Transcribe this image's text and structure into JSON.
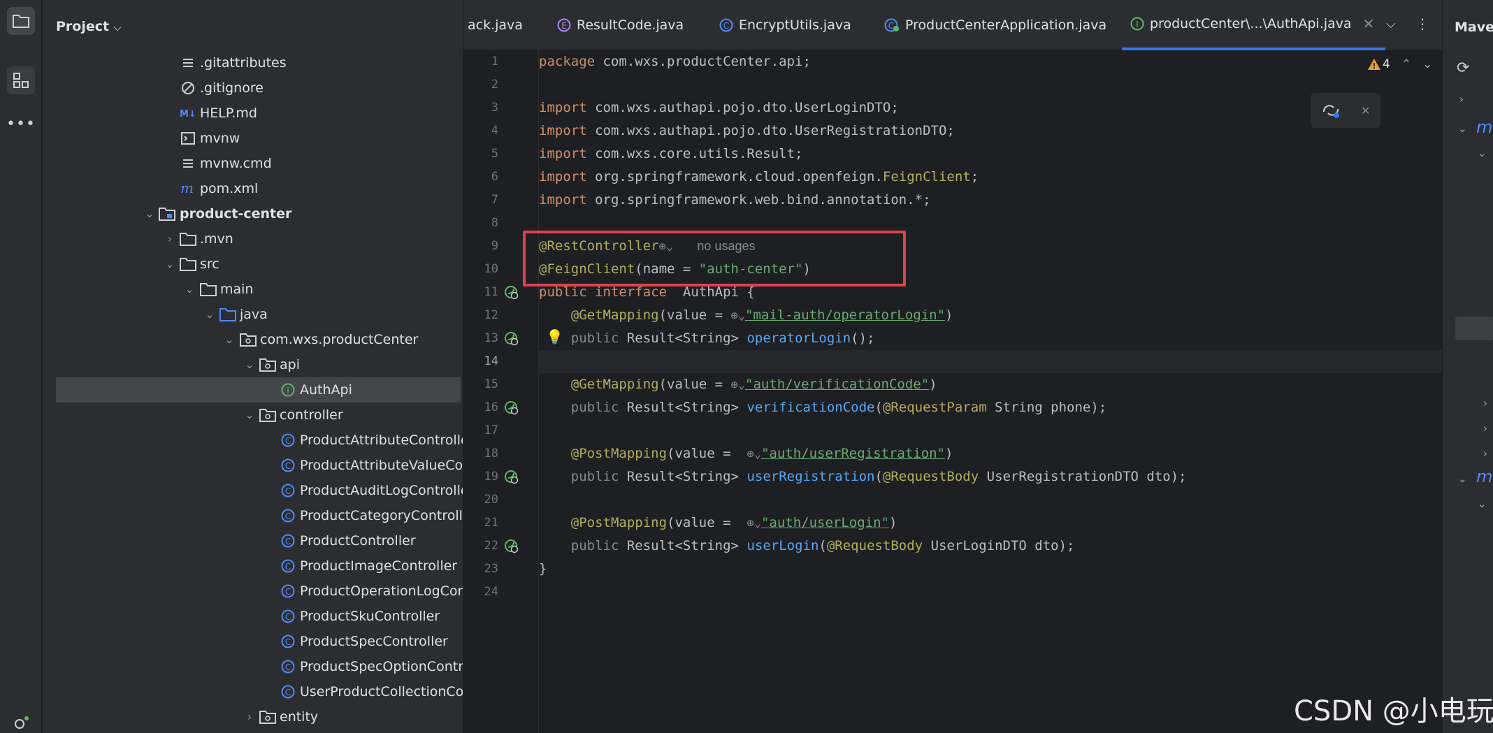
{
  "project_panel": {
    "title": "Project",
    "tree": [
      {
        "label": ".gitattributes",
        "icon": "lines-file-icon",
        "indent": 0
      },
      {
        "label": ".gitignore",
        "icon": "ignore-file-icon",
        "indent": 0
      },
      {
        "label": "HELP.md",
        "icon": "markdown-file-icon",
        "indent": 0
      },
      {
        "label": "mvnw",
        "icon": "terminal-file-icon",
        "indent": 0
      },
      {
        "label": "mvnw.cmd",
        "icon": "lines-file-icon",
        "indent": 0
      },
      {
        "label": "pom.xml",
        "icon": "maven-file-icon",
        "indent": 0
      },
      {
        "label": "product-center",
        "icon": "module-folder-icon",
        "indent": 1
      },
      {
        "label": ".mvn",
        "icon": "folder-icon",
        "indent": 2
      },
      {
        "label": "src",
        "icon": "folder-icon",
        "indent": 3
      },
      {
        "label": "main",
        "icon": "folder-icon",
        "indent": 4
      },
      {
        "label": "java",
        "icon": "source-folder-icon",
        "indent": 5
      },
      {
        "label": "com.wxs.productCenter",
        "icon": "package-icon",
        "indent": 6
      },
      {
        "label": "api",
        "icon": "package-icon",
        "indent": 7
      },
      {
        "label": "AuthApi",
        "icon": "interface-icon",
        "indent": 8
      },
      {
        "label": "controller",
        "icon": "package-icon",
        "indent": 7
      },
      {
        "label": "ProductAttributeController",
        "icon": "class-icon",
        "indent": 8
      },
      {
        "label": "ProductAttributeValueController",
        "icon": "class-icon",
        "indent": 8
      },
      {
        "label": "ProductAuditLogController",
        "icon": "class-icon",
        "indent": 8
      },
      {
        "label": "ProductCategoryController",
        "icon": "class-icon",
        "indent": 8
      },
      {
        "label": "ProductController",
        "icon": "class-icon",
        "indent": 8
      },
      {
        "label": "ProductImageController",
        "icon": "class-icon",
        "indent": 8
      },
      {
        "label": "ProductOperationLogController",
        "icon": "class-icon",
        "indent": 8
      },
      {
        "label": "ProductSkuController",
        "icon": "class-icon",
        "indent": 8
      },
      {
        "label": "ProductSpecController",
        "icon": "class-icon",
        "indent": 8
      },
      {
        "label": "ProductSpecOptionController",
        "icon": "class-icon",
        "indent": 8
      },
      {
        "label": "UserProductCollectionController",
        "icon": "class-icon",
        "indent": 8
      },
      {
        "label": "entity",
        "icon": "package-icon",
        "indent": 7
      }
    ]
  },
  "tabs": [
    {
      "label": "ack.java",
      "icon": ""
    },
    {
      "label": "ResultCode.java",
      "icon": "enum-icon"
    },
    {
      "label": "EncryptUtils.java",
      "icon": "class-icon"
    },
    {
      "label": "ProductCenterApplication.java",
      "icon": "spring-class-icon"
    },
    {
      "label": "productCenter\\...\\AuthApi.java",
      "icon": "interface-icon"
    }
  ],
  "editor": {
    "warning_count": "4",
    "line_numbers": [
      "1",
      "2",
      "3",
      "4",
      "5",
      "6",
      "7",
      "8",
      "9",
      "10",
      "11",
      "12",
      "13",
      "14",
      "15",
      "16",
      "17",
      "18",
      "19",
      "20",
      "21",
      "22",
      "23",
      "24"
    ],
    "lines": {
      "l1": [
        "package",
        " com.wxs.productCenter.api;"
      ],
      "l3": [
        "import",
        " com.wxs.authapi.pojo.dto.UserLoginDTO;"
      ],
      "l4": [
        "import",
        " com.wxs.authapi.pojo.dto.UserRegistrationDTO;"
      ],
      "l5": [
        "import",
        " com.wxs.core.utils.Result;"
      ],
      "l6": [
        "import",
        " org.springframework.cloud.openfeign.",
        "FeignClient",
        ";"
      ],
      "l7": [
        "import",
        " org.springframework.web.bind.annotation.*;"
      ],
      "l9": [
        "@RestController",
        "no usages"
      ],
      "l10": [
        "@FeignClient",
        "(name = ",
        "\"auth-center\"",
        ")"
      ],
      "l11": [
        "public",
        " ",
        "interface",
        "  AuthApi {"
      ],
      "l12": [
        "@GetMapping",
        "(value = ",
        "\"mail-auth/operatorLogin\"",
        ")"
      ],
      "l13": [
        "public",
        " Result<String> ",
        "operatorLogin",
        "();"
      ],
      "l15": [
        "@GetMapping",
        "(value = ",
        "\"auth/verificationCode\"",
        ")"
      ],
      "l16": [
        "public",
        " Result<String> ",
        "verificationCode",
        "(",
        "@RequestParam",
        " String phone);"
      ],
      "l18": [
        "@PostMapping",
        "(value = ",
        "\"auth/userRegistration\"",
        ")"
      ],
      "l19": [
        "public",
        " Result<String> ",
        "userRegistration",
        "(",
        "@RequestBody",
        " UserRegistrationDTO dto);"
      ],
      "l21": [
        "@PostMapping",
        "(value = ",
        "\"auth/userLogin\"",
        ")"
      ],
      "l22": [
        "public",
        " Result<String> ",
        "userLogin",
        "(",
        "@RequestBody",
        " UserLoginDTO dto);"
      ],
      "l23": [
        "}"
      ]
    }
  },
  "right_panel": {
    "title": "Maven"
  },
  "watermark": "CSDN @小电玩"
}
